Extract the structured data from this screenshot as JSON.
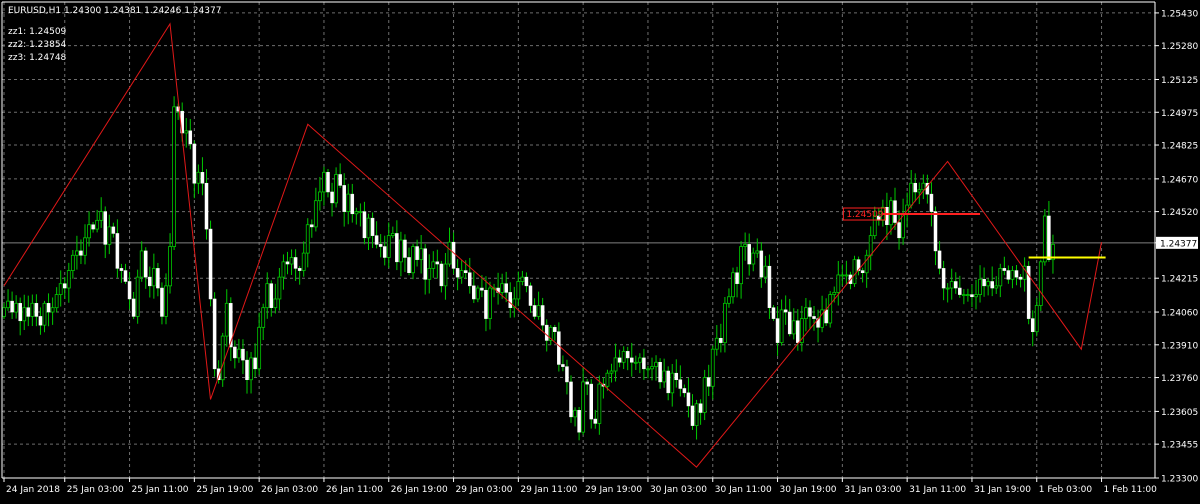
{
  "chart_data": {
    "type": "candlestick",
    "title": "EURUSD,H1  1.24300 1.24381 1.24246 1.24377",
    "symbol": "EURUSD",
    "timeframe": "H1",
    "header_ohlc": [
      "1.24300",
      "1.24381",
      "1.24246",
      "1.24377"
    ],
    "indicators": [
      {
        "label": "zz1",
        "value": "1.24509"
      },
      {
        "label": "zz2",
        "value": "1.23854"
      },
      {
        "label": "zz3",
        "value": "1.24748"
      }
    ],
    "ylim": [
      1.233,
      1.2548
    ],
    "y_ticks": [
      "1.25430",
      "1.25280",
      "1.25125",
      "1.24975",
      "1.24825",
      "1.24670",
      "1.24520",
      "1.24377",
      "1.24215",
      "1.24060",
      "1.23910",
      "1.23760",
      "1.23605",
      "1.23455",
      "1.23300"
    ],
    "current_price": "1.24377",
    "x_ticks": [
      {
        "bar": 0,
        "label": "24 Jan 2018"
      },
      {
        "bar": 15,
        "label": "25 Jan 03:00"
      },
      {
        "bar": 31,
        "label": "25 Jan 11:00"
      },
      {
        "bar": 47,
        "label": "25 Jan 19:00"
      },
      {
        "bar": 63,
        "label": "26 Jan 03:00"
      },
      {
        "bar": 79,
        "label": "26 Jan 11:00"
      },
      {
        "bar": 95,
        "label": "26 Jan 19:00"
      },
      {
        "bar": 111,
        "label": "29 Jan 03:00"
      },
      {
        "bar": 127,
        "label": "29 Jan 11:00"
      },
      {
        "bar": 143,
        "label": "29 Jan 19:00"
      },
      {
        "bar": 159,
        "label": "30 Jan 03:00"
      },
      {
        "bar": 175,
        "label": "30 Jan 11:00"
      },
      {
        "bar": 191,
        "label": "30 Jan 19:00"
      },
      {
        "bar": 207,
        "label": "31 Jan 03:00"
      },
      {
        "bar": 223,
        "label": "31 Jan 11:00"
      },
      {
        "bar": 239,
        "label": "31 Jan 19:00"
      },
      {
        "bar": 255,
        "label": "1 Feb 03:00"
      },
      {
        "bar": 271,
        "label": "1 Feb 11:00"
      }
    ],
    "closes": [
      1.2408,
      1.2411,
      1.2406,
      1.241,
      1.2402,
      1.2408,
      1.2404,
      1.241,
      1.2404,
      1.24,
      1.241,
      1.2406,
      1.2408,
      1.2414,
      1.2419,
      1.2417,
      1.2425,
      1.2432,
      1.2434,
      1.2432,
      1.244,
      1.2446,
      1.2444,
      1.2448,
      1.2452,
      1.2437,
      1.2445,
      1.2442,
      1.2426,
      1.2425,
      1.242,
      1.2412,
      1.2404,
      1.2422,
      1.2434,
      1.2422,
      1.2418,
      1.2426,
      1.2417,
      1.2404,
      1.2418,
      1.2436,
      1.25,
      1.2498,
      1.2488,
      1.2489,
      1.2483,
      1.2465,
      1.247,
      1.2465,
      1.2444,
      1.2412,
      1.238,
      1.2375,
      1.2395,
      1.241,
      1.239,
      1.2385,
      1.2389,
      1.2384,
      1.2375,
      1.2385,
      1.238,
      1.2399,
      1.2408,
      1.2419,
      1.2408,
      1.2412,
      1.2422,
      1.2429,
      1.2428,
      1.2431,
      1.2426,
      1.2425,
      1.2433,
      1.2446,
      1.2445,
      1.2457,
      1.2461,
      1.247,
      1.2461,
      1.2456,
      1.2469,
      1.2464,
      1.2452,
      1.246,
      1.2451,
      1.2452,
      1.2452,
      1.244,
      1.2449,
      1.2441,
      1.2437,
      1.2436,
      1.2431,
      1.2441,
      1.2442,
      1.2429,
      1.2439,
      1.2431,
      1.2424,
      1.2436,
      1.243,
      1.2435,
      1.2421,
      1.2426,
      1.2429,
      1.2428,
      1.2418,
      1.2428,
      1.2438,
      1.2426,
      1.2422,
      1.2425,
      1.2424,
      1.2418,
      1.2412,
      1.2417,
      1.2416,
      1.2403,
      1.2417,
      1.2417,
      1.2415,
      1.2419,
      1.2415,
      1.2408,
      1.2412,
      1.242,
      1.2422,
      1.2418,
      1.2409,
      1.2404,
      1.2409,
      1.24,
      1.2393,
      1.2399,
      1.2397,
      1.2382,
      1.2381,
      1.2374,
      1.2358,
      1.2361,
      1.2351,
      1.2374,
      1.2373,
      1.2357,
      1.2355,
      1.2373,
      1.2372,
      1.2378,
      1.2379,
      1.2385,
      1.2383,
      1.2388,
      1.2385,
      1.2383,
      1.2383,
      1.2385,
      1.238,
      1.238,
      1.2381,
      1.2383,
      1.2374,
      1.2379,
      1.2369,
      1.2378,
      1.2375,
      1.2371,
      1.2369,
      1.2363,
      1.2354,
      1.2364,
      1.236,
      1.2376,
      1.2372,
      1.2389,
      1.2394,
      1.2392,
      1.241,
      1.2413,
      1.2424,
      1.2419,
      1.2436,
      1.2437,
      1.2428,
      1.2433,
      1.2434,
      1.2422,
      1.2427,
      1.2408,
      1.2403,
      1.2392,
      1.2407,
      1.2406,
      1.2396,
      1.2402,
      1.2392,
      1.2403,
      1.2408,
      1.2404,
      1.2403,
      1.2399,
      1.2407,
      1.2401,
      1.2414,
      1.2415,
      1.2423,
      1.2423,
      1.2423,
      1.2419,
      1.243,
      1.2425,
      1.2424,
      1.2432,
      1.2441,
      1.245,
      1.2448,
      1.2454,
      1.2446,
      1.2457,
      1.2447,
      1.244,
      1.2451,
      1.2455,
      1.2465,
      1.2461,
      1.2462,
      1.2465,
      1.246,
      1.2452,
      1.2434,
      1.2426,
      1.2417,
      1.2417,
      1.242,
      1.2417,
      1.2414,
      1.2414,
      1.2414,
      1.2413,
      1.2414,
      1.2421,
      1.2418,
      1.242,
      1.2417,
      1.2418,
      1.2426,
      1.2425,
      1.2421,
      1.2425,
      1.2422,
      1.2421,
      1.2427,
      1.2403,
      1.2397,
      1.2409,
      1.2429,
      1.245,
      1.243,
      1.2437
    ]
  }
}
